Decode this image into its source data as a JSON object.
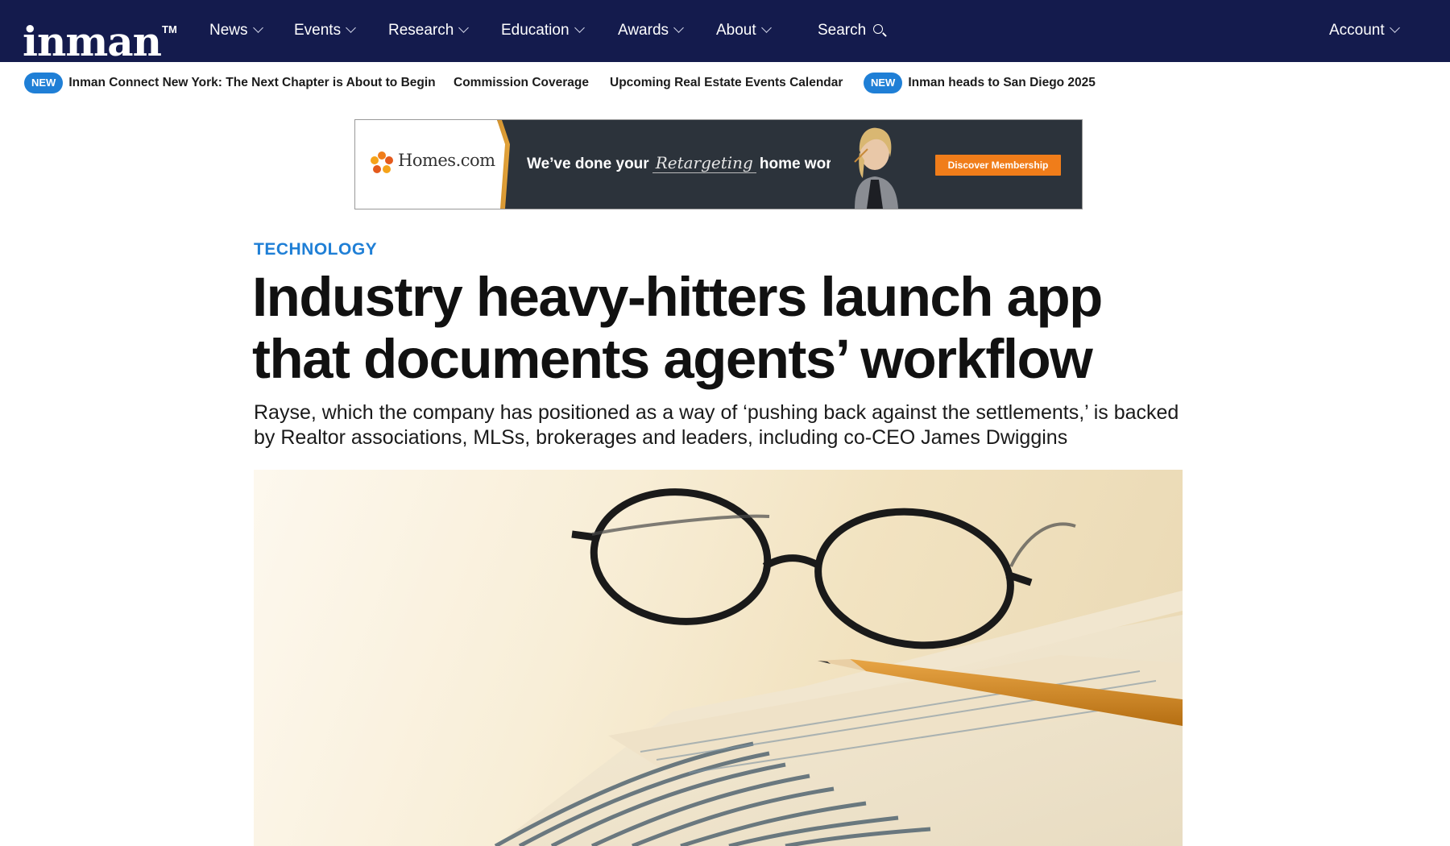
{
  "nav": {
    "logo": "inman",
    "logo_tm": "TM",
    "items": [
      {
        "label": "News"
      },
      {
        "label": "Events"
      },
      {
        "label": "Research"
      },
      {
        "label": "Education"
      },
      {
        "label": "Awards"
      },
      {
        "label": "About"
      }
    ],
    "search_label": "Search",
    "account_label": "Account"
  },
  "ticker": {
    "items": [
      {
        "badge": "NEW",
        "label": "Inman Connect New York: The Next Chapter is About to Begin"
      },
      {
        "badge": "",
        "label": "Commission Coverage"
      },
      {
        "badge": "",
        "label": "Upcoming Real Estate Events Calendar"
      },
      {
        "badge": "NEW",
        "label": "Inman heads to San Diego 2025"
      }
    ]
  },
  "ad": {
    "brand": "Homes.com",
    "headline_pre": "We’ve done your",
    "headline_script": "Retargeting",
    "headline_post": "home work.",
    "cta": "Discover Membership"
  },
  "article": {
    "category": "TECHNOLOGY",
    "headline": "Industry heavy-hitters launch app that documents agents’ workflow",
    "dek": "Rayse, which the company has positioned as a way of ‘pushing back against the settlements,’ is backed by Realtor associations, MLSs, brokerages and leaders, including co-CEO James Dwiggins"
  },
  "colors": {
    "nav_bg": "#141b4d",
    "accent": "#1f7fd6",
    "cta": "#f07d1a"
  },
  "icons": {
    "search": "search-icon",
    "chevron": "chevron-down-icon"
  }
}
